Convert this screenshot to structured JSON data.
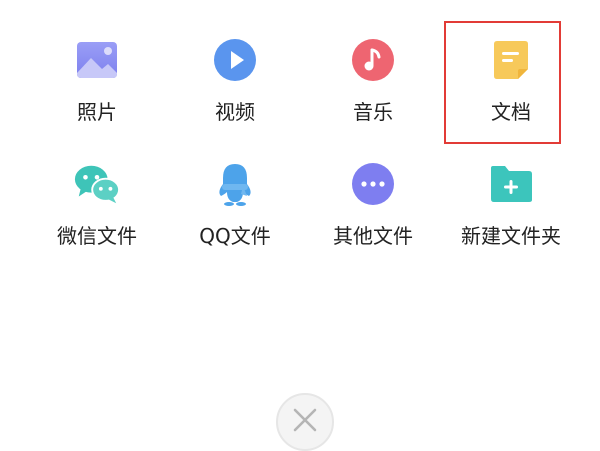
{
  "items": [
    {
      "label": "照片",
      "icon": "photo-icon",
      "color": "#8b8ff2"
    },
    {
      "label": "视频",
      "icon": "video-play-icon",
      "color": "#5a95ee"
    },
    {
      "label": "音乐",
      "icon": "music-note-icon",
      "color": "#ee6571"
    },
    {
      "label": "文档",
      "icon": "document-icon",
      "color": "#f7c95a"
    },
    {
      "label": "微信文件",
      "icon": "wechat-icon",
      "color": "#3ec4b8"
    },
    {
      "label": "QQ文件",
      "icon": "qq-penguin-icon",
      "color": "#4da3ea"
    },
    {
      "label": "其他文件",
      "icon": "more-dots-icon",
      "color": "#7e7ef0"
    },
    {
      "label": "新建文件夹",
      "icon": "new-folder-icon",
      "color": "#3cc5bc"
    }
  ],
  "highlight_color": "#e23b36",
  "close": {
    "icon": "close-icon"
  }
}
